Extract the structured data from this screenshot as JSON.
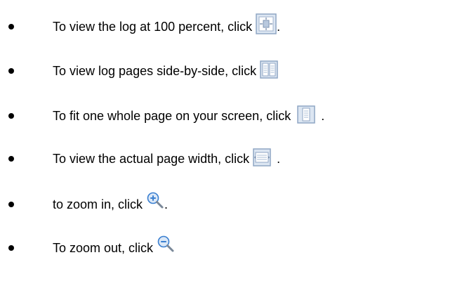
{
  "instructions": [
    {
      "text": "To view the log at 100 percent, click ",
      "icon": "actual-size-icon",
      "after": "."
    },
    {
      "text": "To view log pages side-by-side, click ",
      "icon": "two-page-icon",
      "after": ""
    },
    {
      "text": "To fit one whole page on your screen, click ",
      "icon": "fit-page-icon",
      "after": "."
    },
    {
      "text": "To view the actual page width, click ",
      "icon": "fit-width-icon",
      "after": "."
    },
    {
      "text": "to zoom in, click ",
      "icon": "zoom-in-icon",
      "after": "."
    },
    {
      "text": "To zoom out, click ",
      "icon": "zoom-out-icon",
      "after": ""
    }
  ],
  "colors": {
    "icon_frame": "#8fa6c4",
    "icon_fill": "#dce6f2",
    "zoom_accent": "#3a7fd0"
  }
}
